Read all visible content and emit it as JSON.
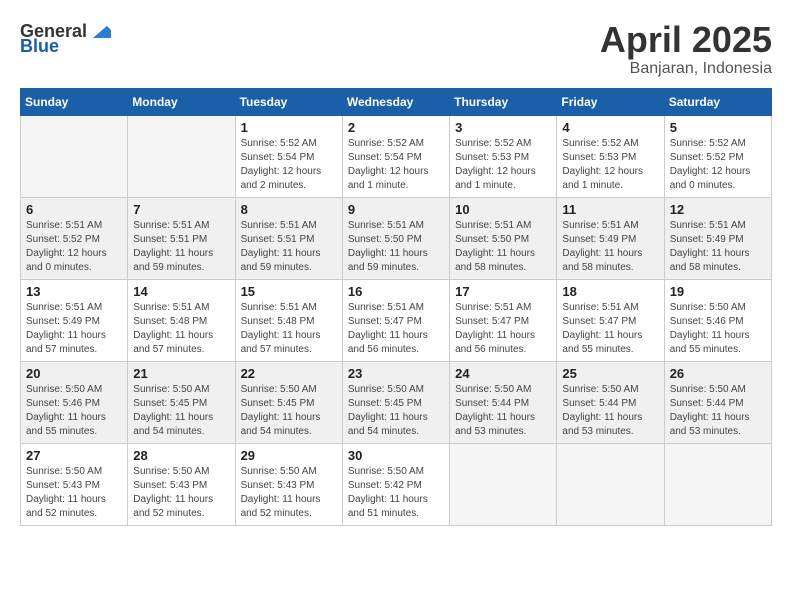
{
  "logo": {
    "general": "General",
    "blue": "Blue"
  },
  "title": "April 2025",
  "location": "Banjaran, Indonesia",
  "days_header": [
    "Sunday",
    "Monday",
    "Tuesday",
    "Wednesday",
    "Thursday",
    "Friday",
    "Saturday"
  ],
  "weeks": [
    [
      {
        "day": "",
        "info": ""
      },
      {
        "day": "",
        "info": ""
      },
      {
        "day": "1",
        "info": "Sunrise: 5:52 AM\nSunset: 5:54 PM\nDaylight: 12 hours\nand 2 minutes."
      },
      {
        "day": "2",
        "info": "Sunrise: 5:52 AM\nSunset: 5:54 PM\nDaylight: 12 hours\nand 1 minute."
      },
      {
        "day": "3",
        "info": "Sunrise: 5:52 AM\nSunset: 5:53 PM\nDaylight: 12 hours\nand 1 minute."
      },
      {
        "day": "4",
        "info": "Sunrise: 5:52 AM\nSunset: 5:53 PM\nDaylight: 12 hours\nand 1 minute."
      },
      {
        "day": "5",
        "info": "Sunrise: 5:52 AM\nSunset: 5:52 PM\nDaylight: 12 hours\nand 0 minutes."
      }
    ],
    [
      {
        "day": "6",
        "info": "Sunrise: 5:51 AM\nSunset: 5:52 PM\nDaylight: 12 hours\nand 0 minutes."
      },
      {
        "day": "7",
        "info": "Sunrise: 5:51 AM\nSunset: 5:51 PM\nDaylight: 11 hours\nand 59 minutes."
      },
      {
        "day": "8",
        "info": "Sunrise: 5:51 AM\nSunset: 5:51 PM\nDaylight: 11 hours\nand 59 minutes."
      },
      {
        "day": "9",
        "info": "Sunrise: 5:51 AM\nSunset: 5:50 PM\nDaylight: 11 hours\nand 59 minutes."
      },
      {
        "day": "10",
        "info": "Sunrise: 5:51 AM\nSunset: 5:50 PM\nDaylight: 11 hours\nand 58 minutes."
      },
      {
        "day": "11",
        "info": "Sunrise: 5:51 AM\nSunset: 5:49 PM\nDaylight: 11 hours\nand 58 minutes."
      },
      {
        "day": "12",
        "info": "Sunrise: 5:51 AM\nSunset: 5:49 PM\nDaylight: 11 hours\nand 58 minutes."
      }
    ],
    [
      {
        "day": "13",
        "info": "Sunrise: 5:51 AM\nSunset: 5:49 PM\nDaylight: 11 hours\nand 57 minutes."
      },
      {
        "day": "14",
        "info": "Sunrise: 5:51 AM\nSunset: 5:48 PM\nDaylight: 11 hours\nand 57 minutes."
      },
      {
        "day": "15",
        "info": "Sunrise: 5:51 AM\nSunset: 5:48 PM\nDaylight: 11 hours\nand 57 minutes."
      },
      {
        "day": "16",
        "info": "Sunrise: 5:51 AM\nSunset: 5:47 PM\nDaylight: 11 hours\nand 56 minutes."
      },
      {
        "day": "17",
        "info": "Sunrise: 5:51 AM\nSunset: 5:47 PM\nDaylight: 11 hours\nand 56 minutes."
      },
      {
        "day": "18",
        "info": "Sunrise: 5:51 AM\nSunset: 5:47 PM\nDaylight: 11 hours\nand 55 minutes."
      },
      {
        "day": "19",
        "info": "Sunrise: 5:50 AM\nSunset: 5:46 PM\nDaylight: 11 hours\nand 55 minutes."
      }
    ],
    [
      {
        "day": "20",
        "info": "Sunrise: 5:50 AM\nSunset: 5:46 PM\nDaylight: 11 hours\nand 55 minutes."
      },
      {
        "day": "21",
        "info": "Sunrise: 5:50 AM\nSunset: 5:45 PM\nDaylight: 11 hours\nand 54 minutes."
      },
      {
        "day": "22",
        "info": "Sunrise: 5:50 AM\nSunset: 5:45 PM\nDaylight: 11 hours\nand 54 minutes."
      },
      {
        "day": "23",
        "info": "Sunrise: 5:50 AM\nSunset: 5:45 PM\nDaylight: 11 hours\nand 54 minutes."
      },
      {
        "day": "24",
        "info": "Sunrise: 5:50 AM\nSunset: 5:44 PM\nDaylight: 11 hours\nand 53 minutes."
      },
      {
        "day": "25",
        "info": "Sunrise: 5:50 AM\nSunset: 5:44 PM\nDaylight: 11 hours\nand 53 minutes."
      },
      {
        "day": "26",
        "info": "Sunrise: 5:50 AM\nSunset: 5:44 PM\nDaylight: 11 hours\nand 53 minutes."
      }
    ],
    [
      {
        "day": "27",
        "info": "Sunrise: 5:50 AM\nSunset: 5:43 PM\nDaylight: 11 hours\nand 52 minutes."
      },
      {
        "day": "28",
        "info": "Sunrise: 5:50 AM\nSunset: 5:43 PM\nDaylight: 11 hours\nand 52 minutes."
      },
      {
        "day": "29",
        "info": "Sunrise: 5:50 AM\nSunset: 5:43 PM\nDaylight: 11 hours\nand 52 minutes."
      },
      {
        "day": "30",
        "info": "Sunrise: 5:50 AM\nSunset: 5:42 PM\nDaylight: 11 hours\nand 51 minutes."
      },
      {
        "day": "",
        "info": ""
      },
      {
        "day": "",
        "info": ""
      },
      {
        "day": "",
        "info": ""
      }
    ]
  ]
}
